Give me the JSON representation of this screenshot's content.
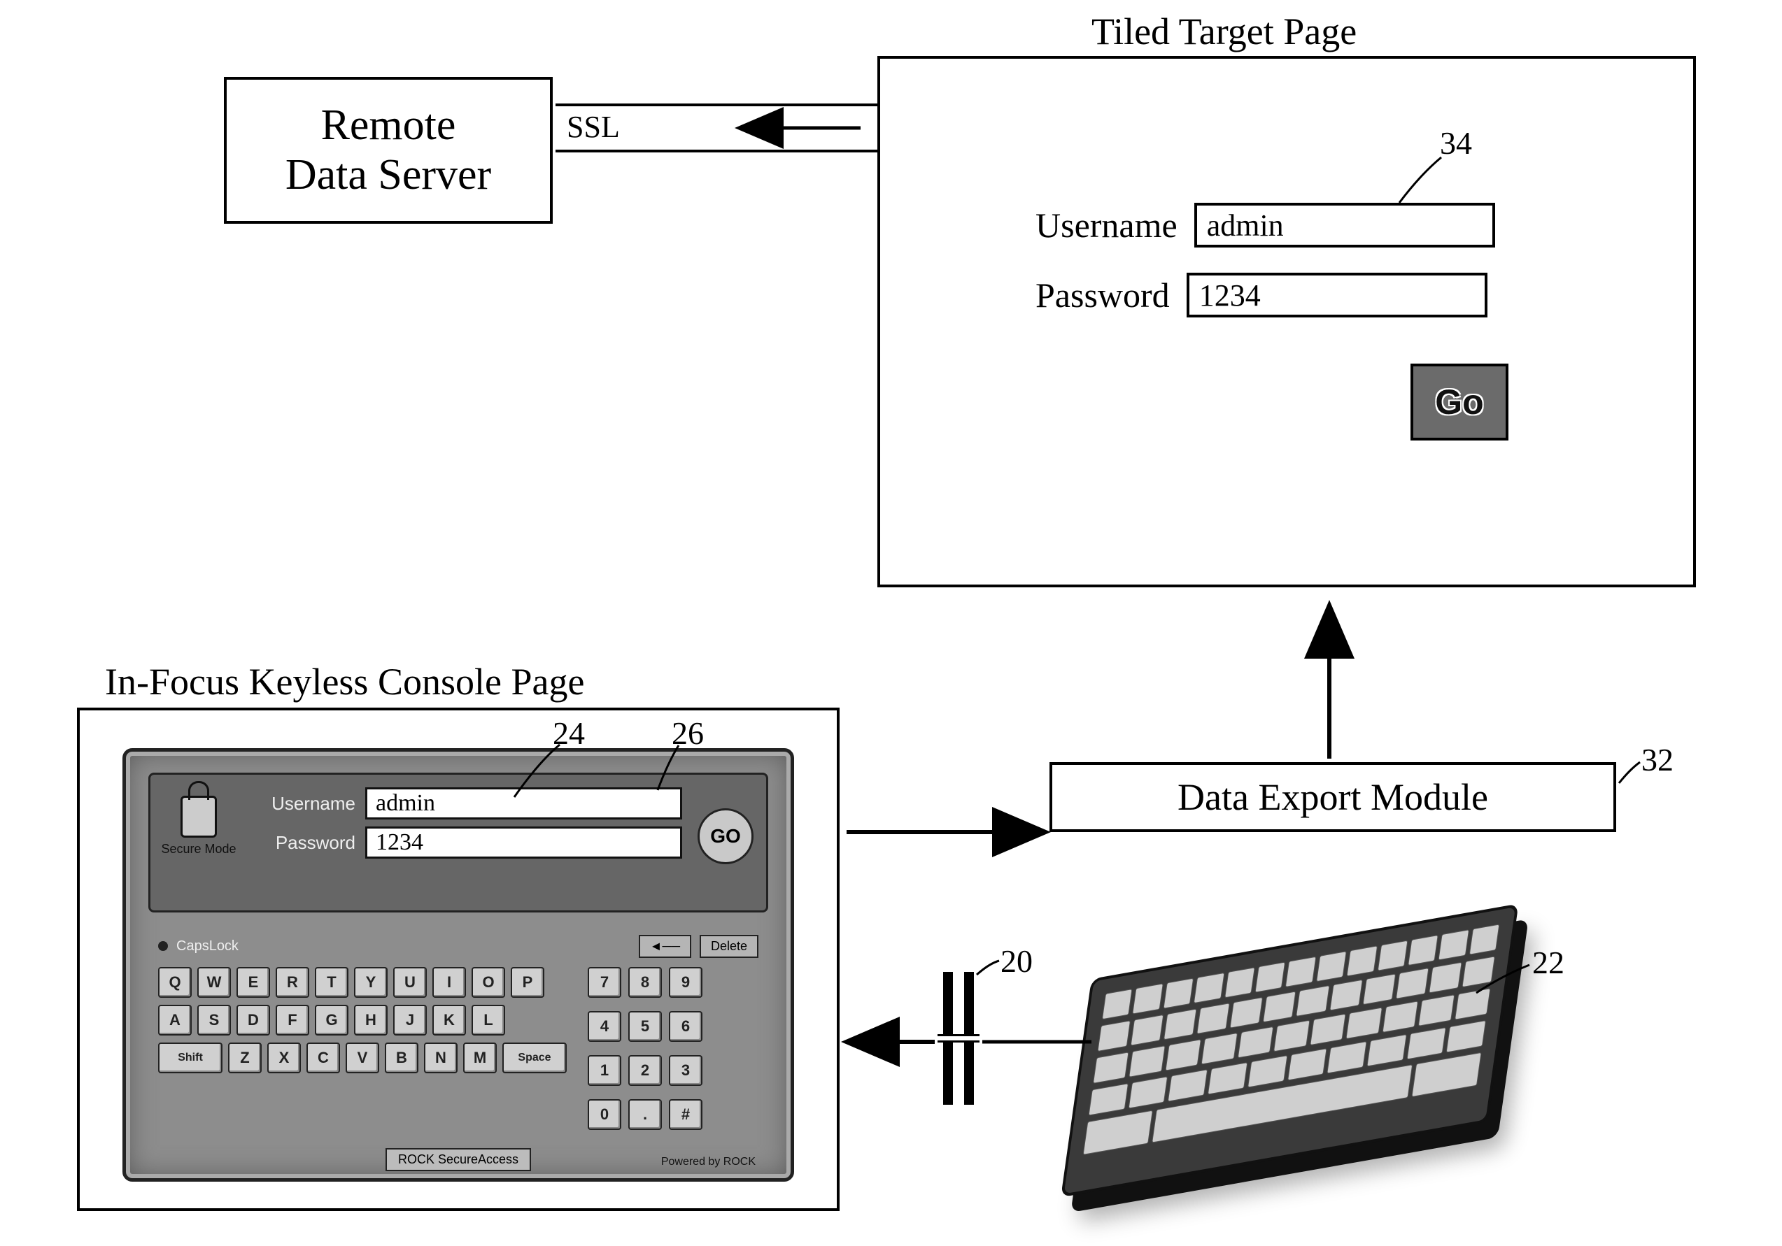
{
  "remote_server": {
    "line1": "Remote",
    "line2": "Data Server"
  },
  "ssl_label": "SSL",
  "target_page": {
    "title": "Tiled Target Page",
    "username_label": "Username",
    "password_label": "Password",
    "username_value": "admin",
    "password_value": "1234",
    "go_label": "Go",
    "ref_username": "34"
  },
  "console": {
    "title": "In-Focus Keyless Console Page",
    "secure_mode": "Secure Mode",
    "username_label": "Username",
    "password_label": "Password",
    "username_value": "admin",
    "password_value": "1234",
    "go_label": "GO",
    "capslock": "CapsLock",
    "backspace": "◄──",
    "delete": "Delete",
    "shift": "Shift",
    "space": "Space",
    "brand": "ROCK SecureAccess",
    "powered": "Powered by ROCK",
    "rows_alpha": [
      [
        "Q",
        "W",
        "E",
        "R",
        "T",
        "Y",
        "U",
        "I",
        "O",
        "P"
      ],
      [
        "A",
        "S",
        "D",
        "F",
        "G",
        "H",
        "J",
        "K",
        "L"
      ],
      [
        "Z",
        "X",
        "C",
        "V",
        "B",
        "N",
        "M"
      ]
    ],
    "numpad": [
      "7",
      "8",
      "9",
      "4",
      "5",
      "6",
      "1",
      "2",
      "3",
      "0",
      ".",
      "#"
    ],
    "ref_username": "24",
    "ref_go": "26"
  },
  "data_export": {
    "label": "Data Export Module",
    "ref": "32"
  },
  "filter": {
    "ref": "20"
  },
  "phys_keyboard": {
    "ref": "22"
  }
}
